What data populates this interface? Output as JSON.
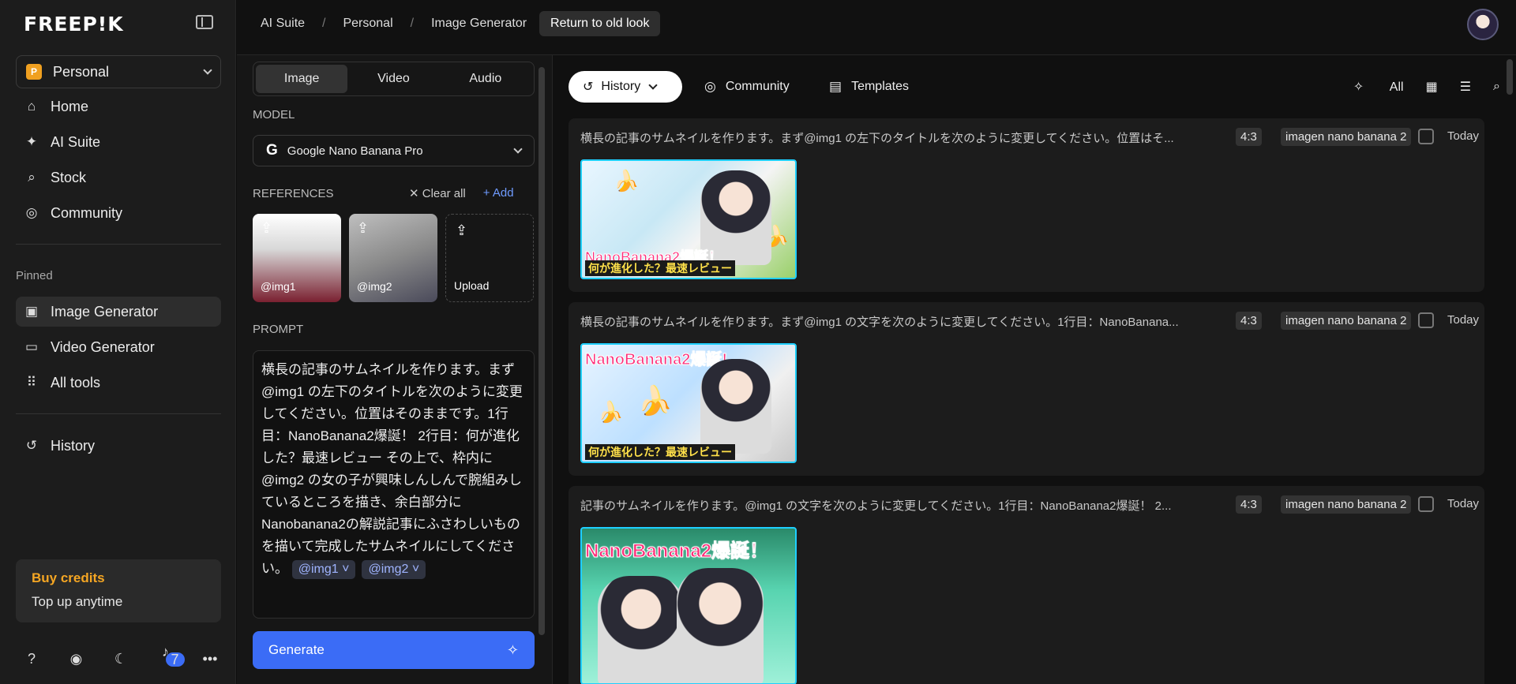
{
  "sidebar": {
    "logo": "FREEP!K",
    "workspace": {
      "badge": "P",
      "label": "Personal"
    },
    "nav": [
      {
        "label": "Home",
        "icon": "home-icon"
      },
      {
        "label": "AI Suite",
        "icon": "sparkle-icon"
      },
      {
        "label": "Stock",
        "icon": "search-icon"
      },
      {
        "label": "Community",
        "icon": "globe-icon"
      }
    ],
    "pinned_label": "Pinned",
    "pinned": [
      {
        "label": "Image Generator",
        "icon": "image-icon"
      },
      {
        "label": "Video Generator",
        "icon": "video-icon"
      },
      {
        "label": "All tools",
        "icon": "grid-icon"
      }
    ],
    "history_label": "History",
    "credits": {
      "title": "Buy credits",
      "subtitle": "Top up anytime"
    },
    "notifications_count": "7"
  },
  "topbar": {
    "breadcrumbs": [
      "AI Suite",
      "Personal",
      "Image Generator"
    ],
    "old_look": "Return to old look"
  },
  "panel": {
    "tabs": [
      "Image",
      "Video",
      "Audio"
    ],
    "model_label": "MODEL",
    "model_value": "Google Nano Banana Pro",
    "references_label": "REFERENCES",
    "clear_all": "Clear all",
    "add": "Add",
    "refs": [
      "@img1",
      "@img2",
      "Upload"
    ],
    "prompt_label": "PROMPT",
    "prompt_text": "横長の記事のサムネイルを作ります。まず@img1 の左下のタイトルを次のように変更してください。位置はそのままです。1行目：NanoBanana2爆誕！ 2行目：何が進化した？最速レビュー その上で、枠内に@img2 の女の子が興味しんしんで腕組みしているところを描き、余白部分にNanobanana2の解説記事にふさわしいものを描いて完成したサムネイルにしてください。",
    "chips": [
      "@img1",
      "@img2"
    ],
    "generate": "Generate"
  },
  "main": {
    "history": "History",
    "community": "Community",
    "templates": "Templates",
    "filter_all": "All",
    "cards": [
      {
        "prompt": "横長の記事のサムネイルを作ります。まず@img1 の左下のタイトルを次のように変更してください。位置はそ...",
        "ratio": "4:3",
        "model": "imagen nano banana 2",
        "date": "Today",
        "thumb_title": "NanoBanana2爆誕！",
        "thumb_sub": "何が進化した？最速レビュー"
      },
      {
        "prompt": "横長の記事のサムネイルを作ります。まず@img1 の文字を次のように変更してください。1行目：NanoBanana...",
        "ratio": "4:3",
        "model": "imagen nano banana 2",
        "date": "Today",
        "thumb_title": "NanoBanana2爆誕!",
        "thumb_sub": "何が進化した？最速レビュー"
      },
      {
        "prompt": "記事のサムネイルを作ります。@img1 の文字を次のように変更してください。1行目：NanoBanana2爆誕！ 2...",
        "ratio": "4:3",
        "model": "imagen nano banana 2",
        "date": "Today",
        "thumb_title": "NanoBanana2爆誕！",
        "thumb_sub": ""
      }
    ]
  }
}
